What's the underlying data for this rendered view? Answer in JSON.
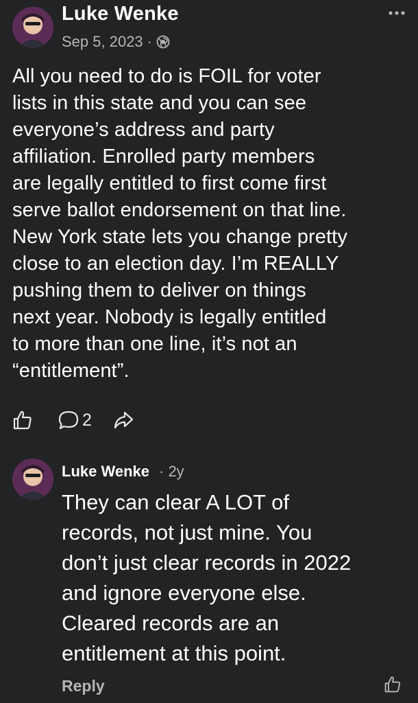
{
  "post": {
    "author": "Luke Wenke",
    "date": "Sep 5, 2023",
    "separator": "·",
    "visibility_icon": "globe-icon",
    "body": "All you need to do is FOIL for voter\nlists in this state and you can see\neveryone’s address and party\naffiliation.  Enrolled party members\nare legally entitled to first come first\nserve ballot endorsement on that line.\nNew York state lets you change pretty\nclose to an election day.  I’m REALLY\npushing them to deliver on things\nnext year.  Nobody is legally entitled\nto more than one line, it’s not an\n“entitlement”.",
    "actions": {
      "like_icon": "thumbs-up-icon",
      "comment_icon": "comment-bubble-icon",
      "comment_count": "2",
      "share_icon": "share-arrow-icon"
    }
  },
  "comment": {
    "author": "Luke Wenke",
    "time": "· 2y",
    "body": "They can clear A LOT of\nrecords, not just mine.  You\ndon’t just clear records in 2022\nand ignore everyone else.\nCleared records are an\nentitlement at this point.",
    "reply_label": "Reply",
    "like_icon": "thumbs-up-icon"
  },
  "colors": {
    "background": "#222325",
    "text": "#ffffff",
    "muted_text": "#b5b6b8"
  }
}
